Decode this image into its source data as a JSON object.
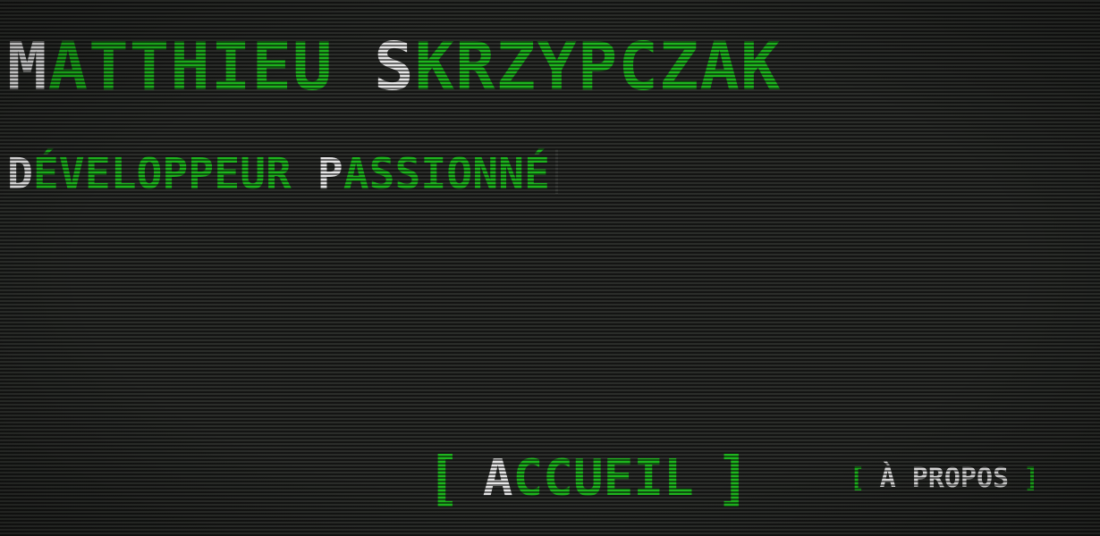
{
  "header": {
    "first_initial": "M",
    "first_rest": "atthieu",
    "last_initial": "S",
    "last_rest": "krzypczak",
    "tagline_word1_initial": "D",
    "tagline_word1_rest": "éveloppeur",
    "tagline_word2_initial": "P",
    "tagline_word2_rest": "assionné"
  },
  "nav": {
    "items": [
      {
        "bracket_open": "[",
        "initial": "A",
        "rest": "ccueil",
        "bracket_close": "]",
        "active": true
      },
      {
        "bracket_open": "[",
        "label": "À propos",
        "bracket_close": "]",
        "active": false
      }
    ]
  },
  "colors": {
    "background": "#2b2d2a",
    "accent_green": "#1fb51f",
    "initial_white": "#e6e6e6"
  }
}
